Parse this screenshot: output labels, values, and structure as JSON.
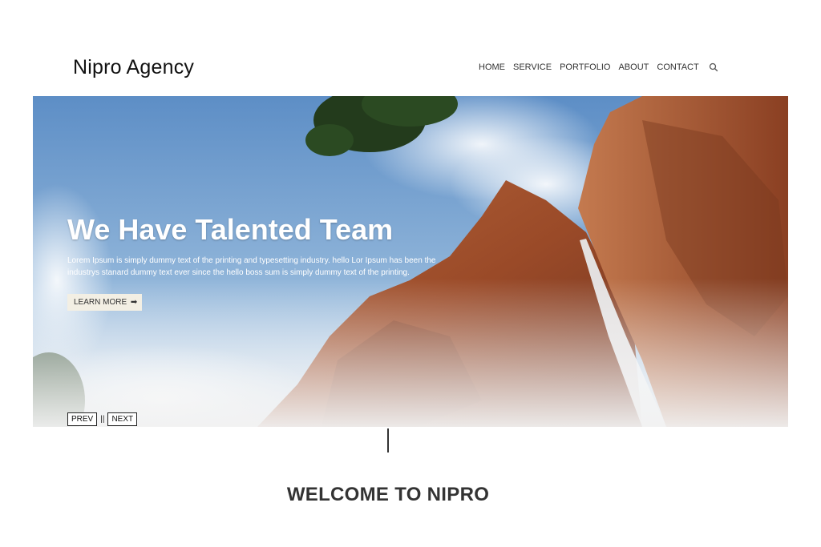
{
  "header": {
    "brand": "Nipro Agency",
    "nav": {
      "items": [
        "HOME",
        "SERVICE",
        "PORTFOLIO",
        "ABOUT",
        "CONTACT"
      ],
      "search_icon": "search-icon"
    }
  },
  "hero": {
    "title": "We Have Talented Team",
    "description": "Lorem Ipsum is simply dummy text of the printing and typesetting industry. hello Lor Ipsum has been the industrys stanard dummy text ever since the hello boss sum is simply dummy text of the printing.",
    "cta_label": "LEARN MORE",
    "cta_icon": "arrow-right-icon",
    "slider": {
      "prev_label": "PREV",
      "separator": "||",
      "next_label": "NEXT"
    }
  },
  "section": {
    "welcome": "WELCOME TO NIPRO"
  },
  "colors": {
    "sky": "#6f9fd0",
    "rock": "#a14f2c",
    "cta_bg": "#f3efe4"
  }
}
